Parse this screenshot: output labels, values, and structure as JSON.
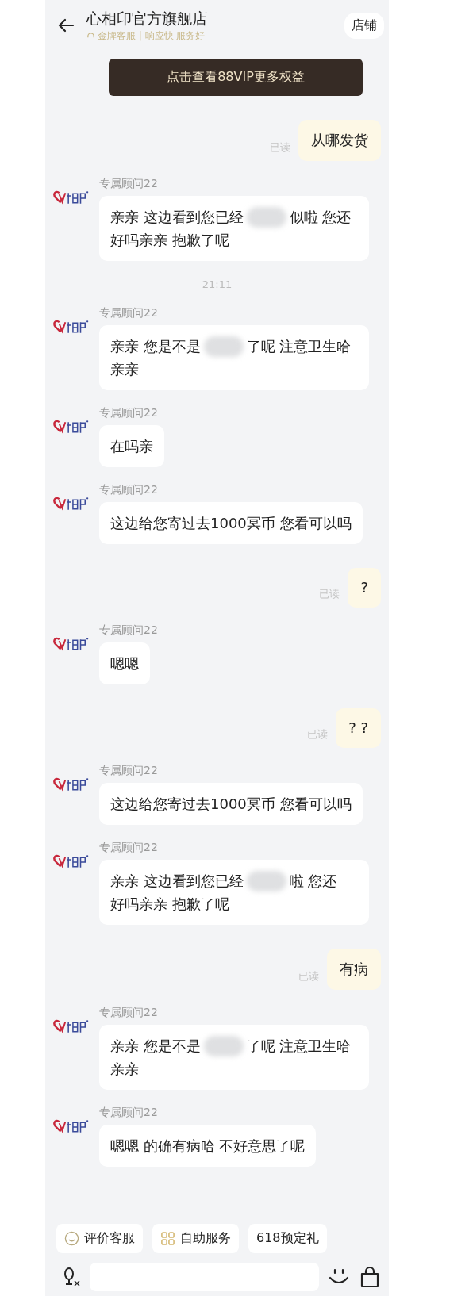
{
  "header": {
    "title": "心相印官方旗舰店",
    "subtitle": "金牌客服 | 响应快 服务好",
    "shop_button": "店铺"
  },
  "vip_banner": "点击查看88VIP更多权益",
  "messages": [
    {
      "kind": "sent",
      "text": "从哪发货",
      "status": "已读"
    },
    {
      "kind": "received",
      "sender": "专属顾问22",
      "text": "亲亲 这边看到您已经",
      "blurred": true,
      "after": "似啦 您还",
      "next_line": "好吗亲亲 抱歉了呢"
    },
    {
      "kind": "time",
      "text": "21:11"
    },
    {
      "kind": "received",
      "sender": "专属顾问22",
      "text": "亲亲 您是不是",
      "blurred": true,
      "after": "了呢 注意卫生哈",
      "next_line": "亲亲"
    },
    {
      "kind": "received",
      "sender": "专属顾问22",
      "text": "在吗亲",
      "blurred": false
    },
    {
      "kind": "received",
      "sender": "专属顾问22",
      "text": "这边给您寄过去1000冥币 您看可以吗",
      "blurred": false
    },
    {
      "kind": "sent",
      "text": "?",
      "status": "已读"
    },
    {
      "kind": "received",
      "sender": "专属顾问22",
      "text": "嗯嗯",
      "blurred": false
    },
    {
      "kind": "sent",
      "text": "? ?",
      "status": "已读"
    },
    {
      "kind": "received",
      "sender": "专属顾问22",
      "text": "这边给您寄过去1000冥币 您看可以吗",
      "blurred": false
    },
    {
      "kind": "received",
      "sender": "专属顾问22",
      "text": "亲亲 这边看到您已经",
      "blurred": true,
      "after": "啦 您还",
      "next_line": "好吗亲亲 抱歉了呢"
    },
    {
      "kind": "sent",
      "text": "有病",
      "status": "已读"
    },
    {
      "kind": "received",
      "sender": "专属顾问22",
      "text": "亲亲 您是不是",
      "blurred": true,
      "after": "了呢 注意卫生哈",
      "next_line": "亲亲"
    },
    {
      "kind": "received",
      "sender": "专属顾问22",
      "text": "嗯嗯 的确有病哈 不好意思了呢",
      "blurred": false
    }
  ],
  "quick_actions": [
    {
      "kind": "smiley",
      "label": "评价客服"
    },
    {
      "kind": "grid",
      "label": "自助服务"
    },
    {
      "kind": "plain",
      "label": "618预定礼"
    }
  ]
}
